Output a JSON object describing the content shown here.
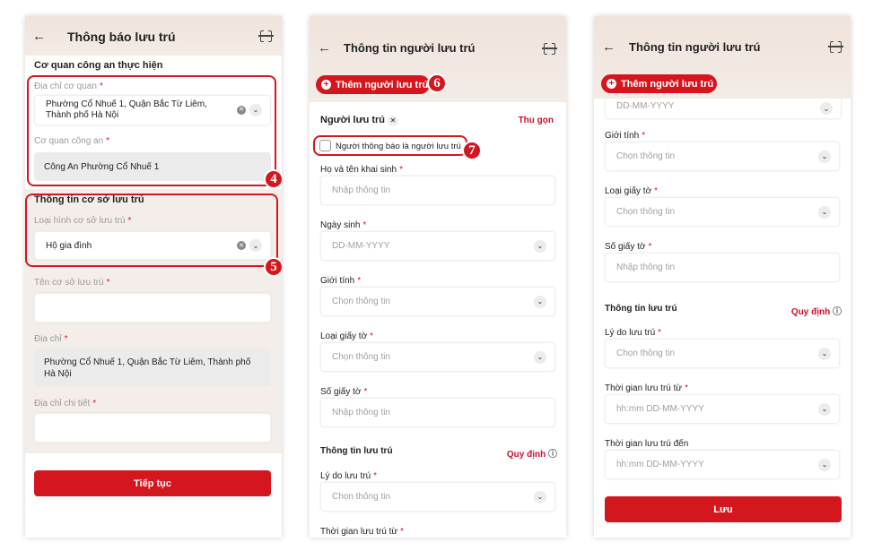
{
  "colors": {
    "accent": "#d4171f",
    "header_bg": "#efe4dc"
  },
  "badges": [
    "4",
    "5",
    "6",
    "7"
  ],
  "panel1": {
    "title": "Thông báo lưu trú",
    "section1": "Cơ quan công an thực hiện",
    "agency_address_label": "Địa chỉ cơ quan",
    "agency_address_value": "Phường Cổ Nhuế 1, Quận Bắc Từ Liêm, Thành phố Hà Nội",
    "police_label": "Cơ quan công an",
    "police_value": "Công An Phường Cổ Nhuế 1",
    "section2": "Thông tin cơ sở lưu trú",
    "type_label": "Loại hình cơ sở lưu trú",
    "type_value": "Hộ gia đình",
    "name_label": "Tên cơ sở lưu trú",
    "address_label": "Địa chỉ",
    "address_value": "Phường Cổ Nhuế 1, Quận Bắc Từ Liêm, Thành phố Hà Nội",
    "detail_label": "Địa chỉ chi tiết",
    "continue": "Tiếp tục"
  },
  "panel2": {
    "title": "Thông tin người lưu trú",
    "add_button": "Thêm người lưu trú",
    "resident_title": "Người lưu trú",
    "collapse": "Thu gọn",
    "checkbox_label": "Người thông báo là người lưu trú",
    "fields": [
      {
        "label": "Họ và tên khai sinh",
        "required": "*",
        "placeholder": "Nhập thông tin",
        "dropdown": false
      },
      {
        "label": "Ngày sinh",
        "required": "*",
        "placeholder": "DD-MM-YYYY",
        "dropdown": true
      },
      {
        "label": "Giới tính",
        "required": "*",
        "placeholder": "Chọn thông tin",
        "dropdown": true
      },
      {
        "label": "Loại giấy tờ",
        "required": "*",
        "placeholder": "Chọn thông tin",
        "dropdown": true
      },
      {
        "label": "Số giấy tờ",
        "required": "*",
        "placeholder": "Nhập thông tin",
        "dropdown": false
      }
    ],
    "stay_section": "Thông tin lưu trú",
    "rules_link": "Quy định",
    "stay_fields": [
      {
        "label": "Lý do lưu trú",
        "required": "*",
        "placeholder": "Chọn thông tin",
        "dropdown": true
      },
      {
        "label": "Thời gian lưu trú từ",
        "required": "*"
      }
    ]
  },
  "panel3": {
    "title": "Thông tin người lưu trú",
    "add_button": "Thêm người lưu trú",
    "top_partial_placeholder": "DD-MM-YYYY",
    "fields": [
      {
        "label": "Giới tính",
        "required": "*",
        "placeholder": "Chọn thông tin",
        "dropdown": true
      },
      {
        "label": "Loại giấy tờ",
        "required": "*",
        "placeholder": "Chọn thông tin",
        "dropdown": true
      },
      {
        "label": "Số giấy tờ",
        "required": "*",
        "placeholder": "Nhập thông tin",
        "dropdown": false
      }
    ],
    "stay_section": "Thông tin lưu trú",
    "rules_link": "Quy định",
    "stay_fields": [
      {
        "label": "Lý do lưu trú",
        "required": "*",
        "placeholder": "Chọn thông tin",
        "dropdown": true
      },
      {
        "label": "Thời gian lưu trú từ",
        "required": "*",
        "placeholder": "hh:mm DD-MM-YYYY",
        "dropdown": true
      },
      {
        "label": "Thời gian lưu trú đến",
        "required": "",
        "placeholder": "hh:mm DD-MM-YYYY",
        "dropdown": true
      }
    ],
    "save": "Lưu"
  }
}
